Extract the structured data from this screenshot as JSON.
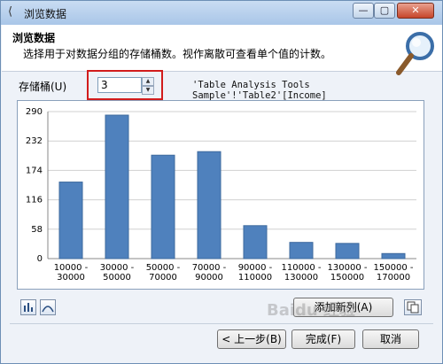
{
  "window": {
    "title": "浏览数据"
  },
  "header": {
    "title": "浏览数据",
    "description": "选择用于对数据分组的存储桶数。视作离散可查看单个值的计数。"
  },
  "bins": {
    "label": "存储桶(U)",
    "value": "3"
  },
  "source_ref": "'Table Analysis Tools Sample'!'Table2'[Income]",
  "chart_data": {
    "type": "bar",
    "categories": [
      "10000 - 30000",
      "30000 - 50000",
      "50000 - 70000",
      "70000 - 90000",
      "90000 - 110000",
      "110000 - 130000",
      "130000 - 150000",
      "150000 - 170000"
    ],
    "category_lines": [
      [
        "10000 -",
        "30000"
      ],
      [
        "30000 -",
        "50000"
      ],
      [
        "50000 -",
        "70000"
      ],
      [
        "70000 -",
        "90000"
      ],
      [
        "90000 -",
        "110000"
      ],
      [
        "110000 -",
        "130000"
      ],
      [
        "130000 -",
        "150000"
      ],
      [
        "150000 -",
        "170000"
      ]
    ],
    "values": [
      151,
      283,
      204,
      211,
      65,
      32,
      30,
      10
    ],
    "yticks": [
      "290",
      "232",
      "174",
      "116",
      "58",
      "0"
    ],
    "ylim": [
      0,
      290
    ],
    "grid": true,
    "color": "#4f81bd"
  },
  "buttons": {
    "add_column": "添加新列(A)",
    "back": "< 上一步(B)",
    "finish": "完成(F)",
    "cancel": "取消"
  },
  "watermark": "Baidu 经验"
}
